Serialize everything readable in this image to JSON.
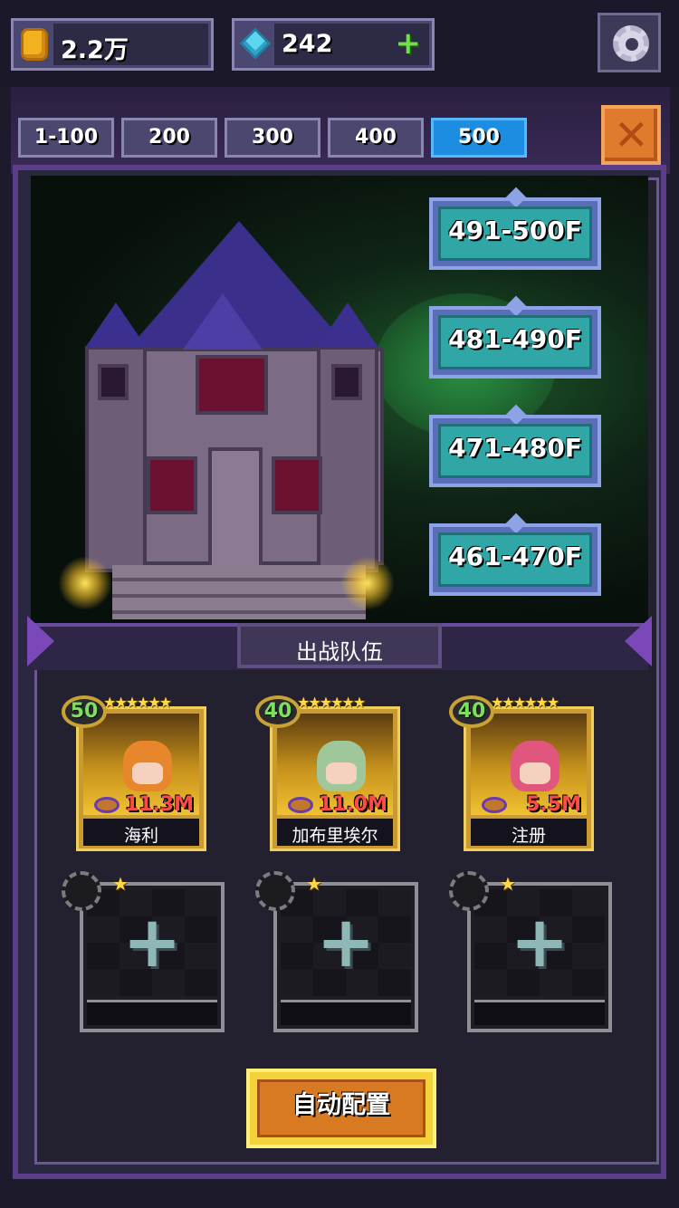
{
  "resources": {
    "gold": {
      "icon": "coin-icon",
      "value": "2.2万"
    },
    "gems": {
      "icon": "gem-icon",
      "value": "242",
      "add_label": "+"
    }
  },
  "settings": {
    "icon": "gear-icon"
  },
  "floor_tabs": [
    {
      "label": "1-100",
      "active": false
    },
    {
      "label": "200",
      "active": false
    },
    {
      "label": "300",
      "active": false
    },
    {
      "label": "400",
      "active": false
    },
    {
      "label": "500",
      "active": true
    }
  ],
  "close": {
    "icon": "close-icon"
  },
  "floor_ranges": [
    {
      "label": "491-500F"
    },
    {
      "label": "481-490F"
    },
    {
      "label": "471-480F"
    },
    {
      "label": "461-470F"
    }
  ],
  "team": {
    "title": "出战队伍",
    "heroes": [
      {
        "name": "海利",
        "level": "50",
        "stars": "★★★★★★",
        "power": "11.3M",
        "hair_color": "#e8862c"
      },
      {
        "name": "加布里埃尔",
        "level": "40",
        "stars": "★★★★★★",
        "power": "11.0M",
        "hair_color": "#9fc79a"
      },
      {
        "name": "注册",
        "level": "40",
        "stars": "★★★★★★",
        "power": "5.5M",
        "hair_color": "#e0567c"
      }
    ],
    "empty_slots": [
      {
        "plus": "+",
        "star": "★"
      },
      {
        "plus": "+",
        "star": "★"
      },
      {
        "plus": "+",
        "star": "★"
      }
    ]
  },
  "auto_configure_label": "自动配置",
  "colors": {
    "active_tab": "#1c8de0",
    "range_button": "#31a6a6",
    "auto_button": "#d77a22",
    "power_text": "#ff4a4a"
  }
}
